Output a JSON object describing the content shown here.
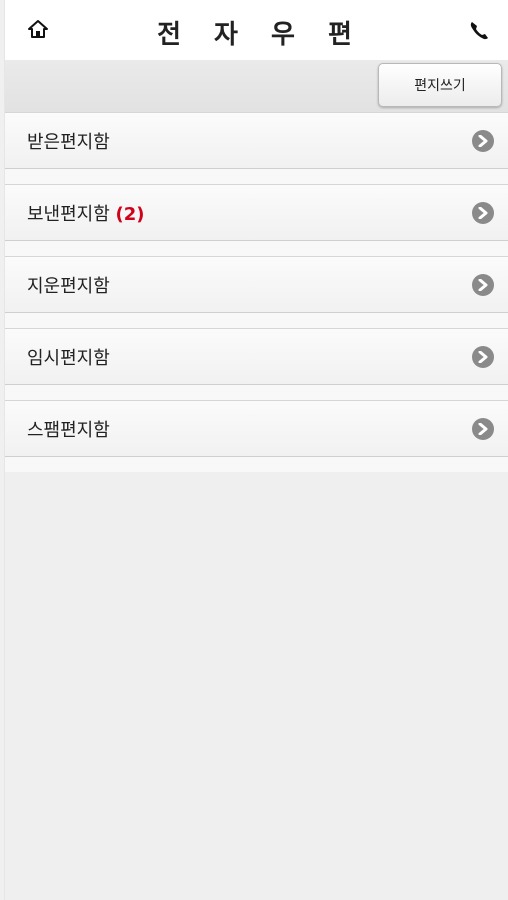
{
  "header": {
    "title": "전 자 우 편",
    "home_icon": "home-icon",
    "phone_icon": "phone-icon"
  },
  "toolbar": {
    "compose_label": "편지쓰기"
  },
  "folders": [
    {
      "label": "받은편지함",
      "count": ""
    },
    {
      "label": "보낸편지함",
      "count": "(2)"
    },
    {
      "label": "지운편지함",
      "count": ""
    },
    {
      "label": "임시편지함",
      "count": ""
    },
    {
      "label": "스팸편지함",
      "count": ""
    }
  ],
  "colors": {
    "count_accent": "#d0021b",
    "arrow": "#8a8a8a"
  }
}
